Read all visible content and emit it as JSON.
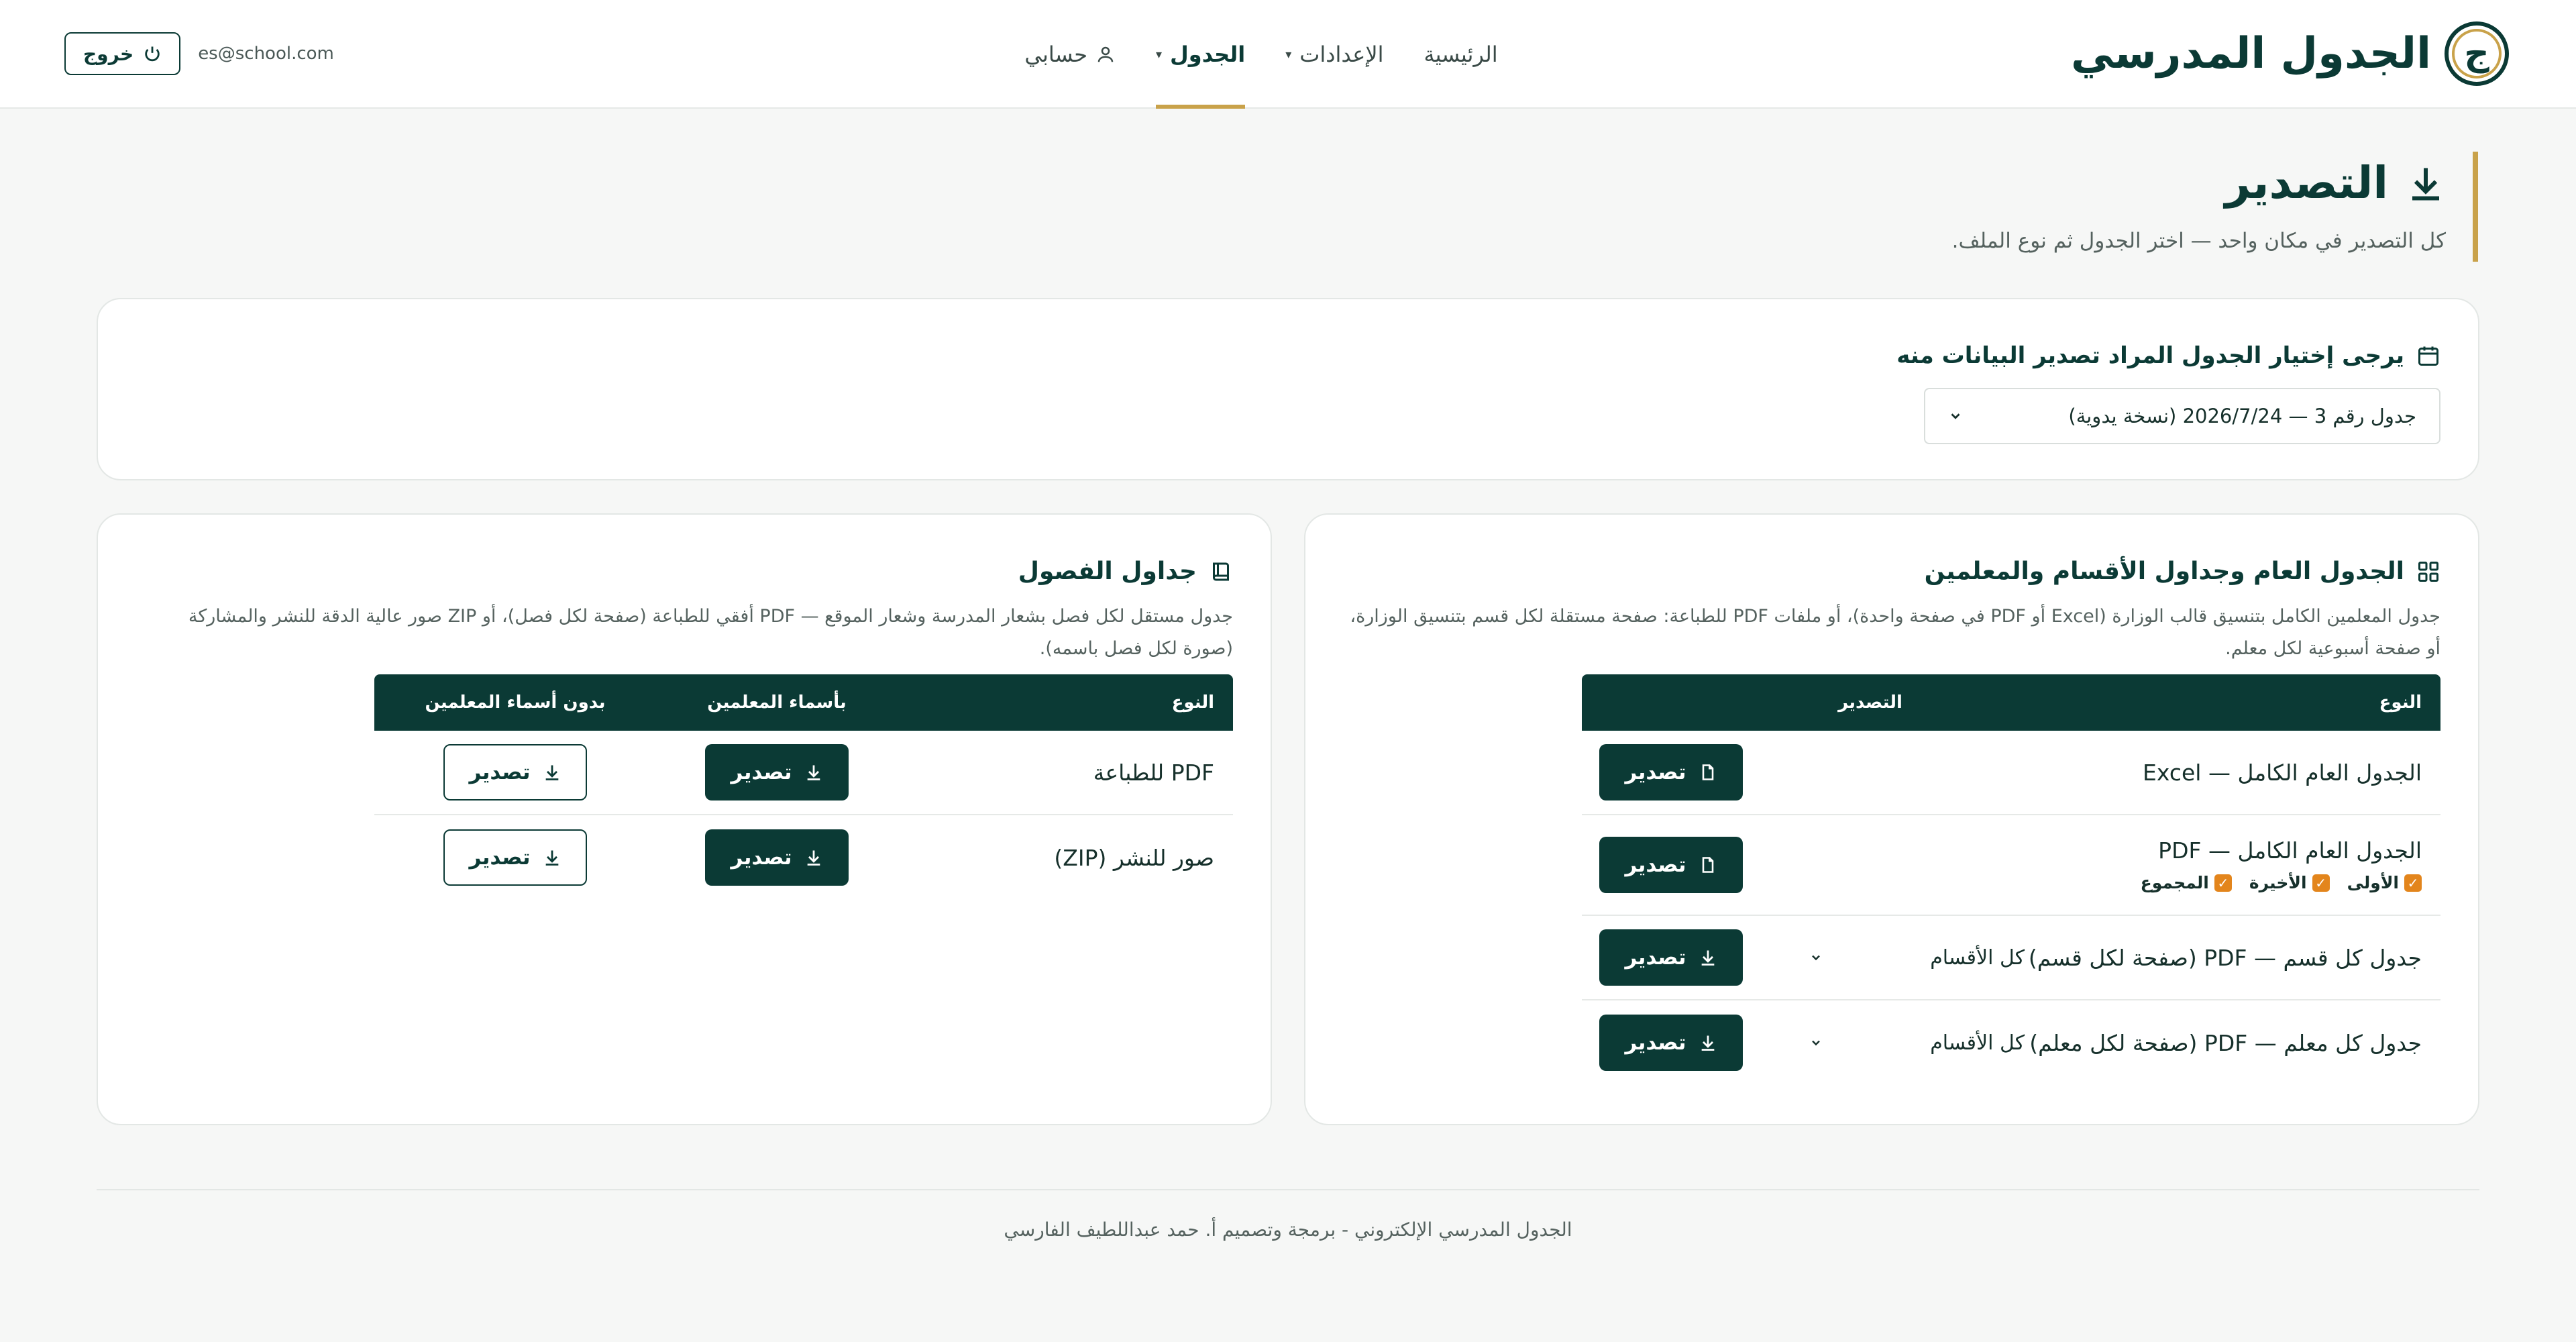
{
  "brand": {
    "title": "الجدول المدرسي",
    "logo_glyph": "ج"
  },
  "nav": {
    "home": "الرئيسية",
    "settings": "الإعدادات",
    "schedule": "الجدول",
    "account": "حسابي"
  },
  "header": {
    "email": "es@school.com",
    "logout": "خروج"
  },
  "page": {
    "title": "التصدير",
    "subtitle": "كل التصدير في مكان واحد — اختر الجدول ثم نوع الملف."
  },
  "select_card": {
    "label": "يرجى إختيار الجدول المراد تصدير البيانات منه",
    "selected": "جدول رقم 3 — 2026/7/24 (نسخة يدوية)"
  },
  "general": {
    "title": "الجدول العام وجداول الأقسام والمعلمين",
    "description": "جدول المعلمين الكامل بتنسيق قالب الوزارة (Excel أو PDF في صفحة واحدة)، أو ملفات PDF للطباعة: صفحة مستقلة لكل قسم بتنسيق الوزارة، أو صفحة أسبوعية لكل معلم.",
    "col_type": "النوع",
    "col_export": "التصدير",
    "export_label": "تصدير",
    "rows": [
      {
        "type": "الجدول العام الكامل — Excel"
      },
      {
        "type": "الجدول العام الكامل — PDF",
        "checks": [
          "الأولى",
          "الأخيرة",
          "المجموع"
        ]
      },
      {
        "type": "جدول كل قسم — PDF (صفحة لكل قسم)",
        "filter": "كل الأقسام"
      },
      {
        "type": "جدول كل معلم — PDF (صفحة لكل معلم)",
        "filter": "كل الأقسام"
      }
    ]
  },
  "classes": {
    "title": "جداول الفصول",
    "description": "جدول مستقل لكل فصل بشعار المدرسة وشعار الموقع — PDF أفقي للطباعة (صفحة لكل فصل)، أو ZIP صور عالية الدقة للنشر والمشاركة (صورة لكل فصل باسمه).",
    "col_type": "النوع",
    "col_with": "بأسماء المعلمين",
    "col_without": "بدون أسماء المعلمين",
    "export_label": "تصدير",
    "rows": [
      {
        "type": "PDF للطباعة"
      },
      {
        "type": "صور للنشر (ZIP)"
      }
    ]
  },
  "footer": "الجدول المدرسي الإلكتروني - برمجة وتصميم أ. حمد عبداللطيف الفارسي",
  "colors": {
    "primary": "#0b3a35",
    "accent": "#c9a24a",
    "check": "#e3851c"
  }
}
